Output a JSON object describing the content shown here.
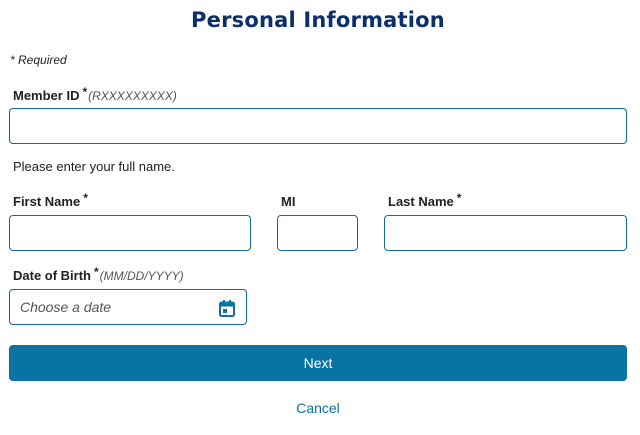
{
  "header": {
    "title": "Personal Information"
  },
  "form": {
    "required_note": "* Required",
    "member_id": {
      "label": "Member ID",
      "required_mark": "*",
      "format_hint": "(RXXXXXXXXX)",
      "value": "",
      "placeholder": ""
    },
    "name_instruction": "Please enter your full name.",
    "first_name": {
      "label": "First Name",
      "required_mark": "*",
      "value": "",
      "placeholder": ""
    },
    "middle_initial": {
      "label": "MI",
      "value": "",
      "placeholder": ""
    },
    "last_name": {
      "label": "Last Name",
      "required_mark": "*",
      "value": "",
      "placeholder": ""
    },
    "date_of_birth": {
      "label": "Date of Birth",
      "required_mark": "*",
      "format_hint": "(MM/DD/YYYY)",
      "value": "",
      "placeholder": "Choose a date",
      "icon": "calendar-icon"
    }
  },
  "actions": {
    "next_label": "Next",
    "cancel_label": "Cancel"
  },
  "colors": {
    "title": "#0b2f6b",
    "accent": "#0a73a6",
    "field_border": "#0e6a9e",
    "text": "#222222"
  }
}
